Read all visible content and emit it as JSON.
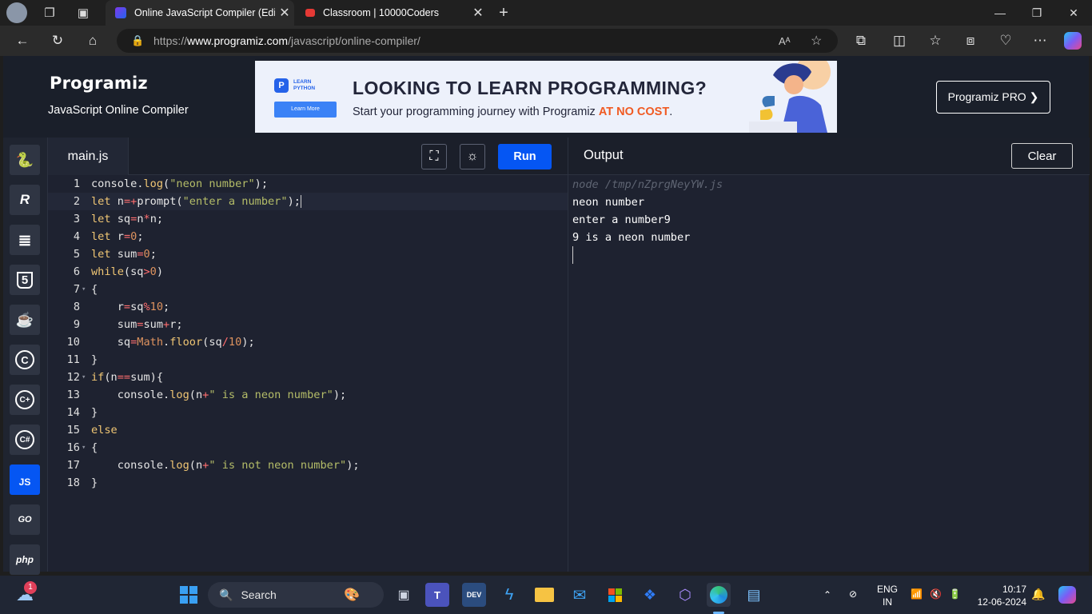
{
  "browser": {
    "tabs": [
      {
        "title": "Online JavaScript Compiler (Edito",
        "active": true
      },
      {
        "title": "Classroom | 10000Coders",
        "active": false
      }
    ],
    "url": {
      "scheme": "https://",
      "host": "www.programiz.com",
      "path": "/javascript/online-compiler/"
    }
  },
  "header": {
    "logo": "Programiz",
    "subtitle": "JavaScript Online Compiler",
    "pro_button": "Programiz PRO ❯",
    "banner": {
      "logo_line1": "LEARN",
      "logo_line2": "PYTHON",
      "learn_more": "Learn More",
      "headline": "LOOKING TO LEARN PROGRAMMING?",
      "sub": "Start your programming journey with Programiz ",
      "sub_emphasis": "AT NO COST",
      "sub_end": "."
    }
  },
  "rail": {
    "items": [
      {
        "name": "python",
        "glyph": "🐍"
      },
      {
        "name": "r",
        "glyph": "R"
      },
      {
        "name": "sql",
        "glyph": "≣"
      },
      {
        "name": "html",
        "glyph": "5"
      },
      {
        "name": "java",
        "glyph": "☕"
      },
      {
        "name": "c",
        "glyph": "C"
      },
      {
        "name": "cpp",
        "glyph": "C+"
      },
      {
        "name": "csharp",
        "glyph": "C#"
      },
      {
        "name": "js",
        "glyph": "JS",
        "active": true
      },
      {
        "name": "go",
        "glyph": "GO"
      },
      {
        "name": "php",
        "glyph": "php"
      }
    ]
  },
  "editor": {
    "file_name": "main.js",
    "run_label": "Run",
    "lines": [
      {
        "n": "1",
        "fold": false
      },
      {
        "n": "2",
        "fold": false
      },
      {
        "n": "3",
        "fold": false
      },
      {
        "n": "4",
        "fold": false
      },
      {
        "n": "5",
        "fold": false
      },
      {
        "n": "6",
        "fold": false
      },
      {
        "n": "7",
        "fold": true
      },
      {
        "n": "8",
        "fold": false
      },
      {
        "n": "9",
        "fold": false
      },
      {
        "n": "10",
        "fold": false
      },
      {
        "n": "11",
        "fold": false
      },
      {
        "n": "12",
        "fold": true
      },
      {
        "n": "13",
        "fold": false
      },
      {
        "n": "14",
        "fold": false
      },
      {
        "n": "15",
        "fold": false
      },
      {
        "n": "16",
        "fold": true
      },
      {
        "n": "17",
        "fold": false
      },
      {
        "n": "18",
        "fold": false
      }
    ]
  },
  "output": {
    "title": "Output",
    "clear_label": "Clear",
    "lines": [
      {
        "text": "node /tmp/nZprgNeyYW.js",
        "cmd": true
      },
      {
        "text": "neon number",
        "cmd": false
      },
      {
        "text": "enter a number9",
        "cmd": false
      },
      {
        "text": "9 is a neon number",
        "cmd": false
      }
    ]
  },
  "taskbar": {
    "search": "Search",
    "weather_badge": "1",
    "lang_line1": "ENG",
    "lang_line2": "IN",
    "time": "10:17",
    "date": "12-06-2024"
  },
  "colors": {
    "run_blue": "#0556f3",
    "page_bg": "#181d27",
    "accent_orange": "#f05a22"
  }
}
